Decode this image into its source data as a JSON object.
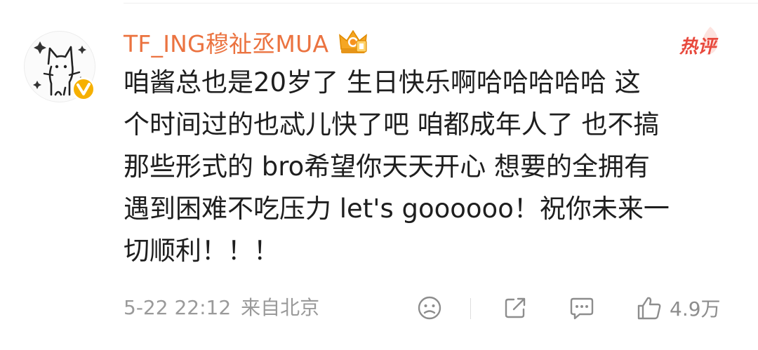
{
  "comment": {
    "username": "TF_ING穆祉丞MUA",
    "hot_label": "热评",
    "lines": [
      "咱酱总也是20岁了  生日快乐啊哈哈哈哈哈 这",
      "个时间过的也忒儿快了吧 咱都成年人了 也不搞",
      "那些形式的 bro希望你天天开心 想要的全拥有",
      "遇到困难不吃压力 let's goooooo！祝你未来一",
      "切顺利！！！"
    ],
    "date": "5-22 22:12",
    "location": "来自北京",
    "like_count": "4.9万"
  },
  "colors": {
    "username": "#eb7340",
    "hot": "#e8493d",
    "verified": "#f6b000",
    "meta": "#9a9a9a",
    "text": "#1e1e1e"
  },
  "icons": {
    "avatar": "avatar-doodle",
    "verified": "verified-v-icon",
    "rank": "crown-rank-icon",
    "reaction": "face-icon",
    "share": "share-icon",
    "comment": "comment-icon",
    "like": "thumbs-up-icon"
  }
}
